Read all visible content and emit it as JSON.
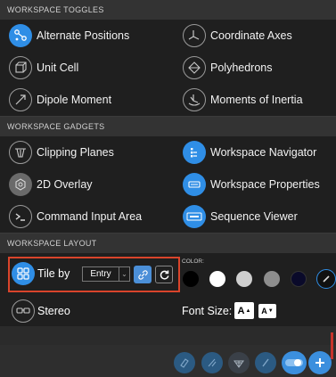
{
  "sections": {
    "toggles_title": "WORKSPACE TOGGLES",
    "gadgets_title": "WORKSPACE GADGETS",
    "layout_title": "WORKSPACE LAYOUT"
  },
  "toggles": [
    {
      "label": "Alternate Positions",
      "icon": "alternate-positions-icon",
      "active": true
    },
    {
      "label": "Coordinate Axes",
      "icon": "coordinate-axes-icon",
      "active": false
    },
    {
      "label": "Unit Cell",
      "icon": "unit-cell-icon",
      "active": false
    },
    {
      "label": "Polyhedrons",
      "icon": "polyhedrons-icon",
      "active": false
    },
    {
      "label": "Dipole Moment",
      "icon": "dipole-moment-icon",
      "active": false
    },
    {
      "label": "Moments of Inertia",
      "icon": "moments-of-inertia-icon",
      "active": false
    }
  ],
  "gadgets": [
    {
      "label": "Clipping Planes",
      "icon": "clipping-planes-icon",
      "active": false
    },
    {
      "label": "Workspace Navigator",
      "icon": "workspace-navigator-icon",
      "active": true
    },
    {
      "label": "2D Overlay",
      "icon": "2d-overlay-icon",
      "active": false
    },
    {
      "label": "Workspace Properties",
      "icon": "workspace-properties-icon",
      "active": true
    },
    {
      "label": "Command Input Area",
      "icon": "command-input-icon",
      "active": false
    },
    {
      "label": "Sequence Viewer",
      "icon": "sequence-viewer-icon",
      "active": true
    }
  ],
  "layout": {
    "tile_by_label": "Tile by",
    "tile_select_value": "Entry",
    "stereo_label": "Stereo",
    "color_label": "COLOR:",
    "font_size_label": "Font Size:",
    "font_increase": "A",
    "font_decrease": "A"
  },
  "colors": {
    "accent_blue": "#2f8ee6",
    "highlight_red": "#d9442b",
    "swatches": [
      "#000000",
      "#ffffff",
      "#cfcfcf",
      "#8e8e8e",
      "#0a0a2a"
    ]
  }
}
